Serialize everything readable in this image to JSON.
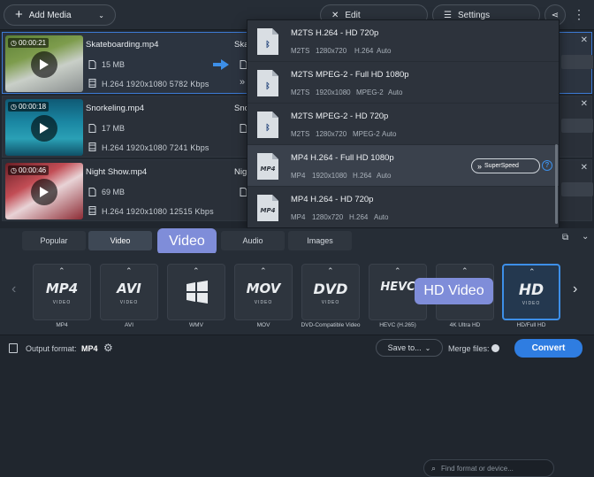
{
  "toolbar": {
    "add_media": "Add Media",
    "edit": "Edit",
    "settings": "Settings"
  },
  "files": [
    {
      "duration": "00:00:21",
      "name": "Skateboarding.mp4",
      "size": "15 MB",
      "info": "H.264 1920x1080 5782 Kbps",
      "out_name": "Ska"
    },
    {
      "duration": "00:00:18",
      "name": "Snorkeling.mp4",
      "size": "17 MB",
      "info": "H.264 1920x1080 7241 Kbps",
      "out_name": "Sno"
    },
    {
      "duration": "00:00:46",
      "name": "Night Show.mp4",
      "size": "69 MB",
      "info": "H.264 1920x1080 12515 Kbps",
      "out_name": "Nig"
    }
  ],
  "presets": [
    {
      "title": "M2TS H.264 - HD 720p",
      "spec": [
        "M2TS",
        "1280x720",
        "H.264",
        "Auto"
      ],
      "icon": "bluray-icon"
    },
    {
      "title": "M2TS MPEG-2 - Full HD 1080p",
      "spec": [
        "M2TS",
        "1920x1080",
        "MPEG-2",
        "Auto"
      ],
      "icon": "bluray-icon"
    },
    {
      "title": "M2TS MPEG-2 - HD 720p",
      "spec": [
        "M2TS",
        "1280x720",
        "MPEG-2",
        "Auto"
      ],
      "icon": "bluray-icon"
    },
    {
      "title": "MP4 H.264 - Full HD 1080p",
      "spec": [
        "MP4",
        "1920x1080",
        "H.264",
        "Auto"
      ],
      "icon": "mp4-file-icon",
      "superspeed": "SuperSpeed"
    },
    {
      "title": "MP4 H.264 - HD 720p",
      "spec": [
        "MP4",
        "1280x720",
        "H.264",
        "Auto"
      ],
      "icon": "mp4-file-icon"
    }
  ],
  "tabs": {
    "popular": "Popular",
    "video": "Video",
    "audio": "Audio",
    "images": "Images"
  },
  "callouts": {
    "video": "Video",
    "hd_video": "HD Video"
  },
  "search": {
    "placeholder": "Find format or device..."
  },
  "formats": [
    {
      "logo": "MP4",
      "label": "MP4"
    },
    {
      "logo": "AVI",
      "label": "AVI"
    },
    {
      "logo": "WMV",
      "label": "WMV"
    },
    {
      "logo": "MOV",
      "label": "MOV"
    },
    {
      "logo": "DVD",
      "label": "DVD-Compatible Video"
    },
    {
      "logo": "HEVC",
      "label": "HEVC (H.265)"
    },
    {
      "logo": "4K",
      "label": "4K Ultra HD"
    },
    {
      "logo": "HD",
      "label": "HD/Full HD"
    }
  ],
  "bottom": {
    "output_format_label": "Output format:",
    "output_format_value": "MP4",
    "save_to": "Save to...",
    "merge_files": "Merge files:",
    "convert": "Convert"
  },
  "colors": {
    "accent": "#3d8fe8",
    "convert": "#2f7de1",
    "callout": "#7f8dd9"
  }
}
